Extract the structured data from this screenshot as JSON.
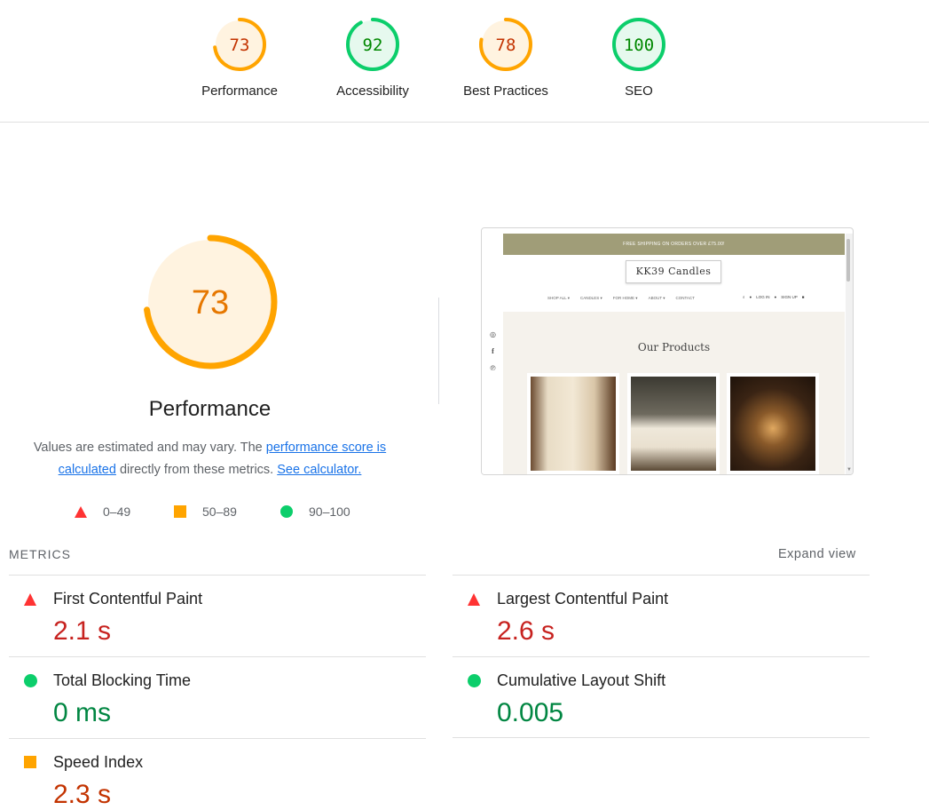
{
  "gauges": [
    {
      "label": "Performance",
      "score": "73",
      "value": 0.73,
      "color": "#ffa400",
      "bg": "#fff3e0",
      "text": "#c33300"
    },
    {
      "label": "Accessibility",
      "score": "92",
      "value": 0.92,
      "color": "#0cce6b",
      "bg": "#e6f9ee",
      "text": "#008800"
    },
    {
      "label": "Best Practices",
      "score": "78",
      "value": 0.78,
      "color": "#ffa400",
      "bg": "#fff3e0",
      "text": "#c33300"
    },
    {
      "label": "SEO",
      "score": "100",
      "value": 1.0,
      "color": "#0cce6b",
      "bg": "#e6f9ee",
      "text": "#008800"
    }
  ],
  "performance": {
    "score": "73",
    "value": 0.73,
    "title": "Performance",
    "desc_prefix": "Values are estimated and may vary. The ",
    "link1": "performance score is calculated",
    "desc_mid": " directly from these metrics. ",
    "link2": "See calculator."
  },
  "legend": [
    {
      "shape": "triangle",
      "range": "0–49"
    },
    {
      "shape": "square",
      "range": "50–89"
    },
    {
      "shape": "circle",
      "range": "90–100"
    }
  ],
  "thumbnail": {
    "banner": "FREE SHIPPING ON ORDERS OVER £75.00!",
    "logo": "KK39 Candles",
    "nav": [
      "SHOP ALL ▾",
      "CANDLES ▾",
      "FOR HOME ▾",
      "ABOUT ▾",
      "CONTACT"
    ],
    "account": [
      "LOG IN",
      "SIGN UP"
    ],
    "section_title": "Our Products"
  },
  "metrics": {
    "header": "METRICS",
    "expand": "Expand view",
    "items": [
      {
        "name": "First Contentful Paint",
        "value": "2.1 s",
        "status": "red"
      },
      {
        "name": "Largest Contentful Paint",
        "value": "2.6 s",
        "status": "red"
      },
      {
        "name": "Total Blocking Time",
        "value": "0 ms",
        "status": "green"
      },
      {
        "name": "Cumulative Layout Shift",
        "value": "0.005",
        "status": "green"
      },
      {
        "name": "Speed Index",
        "value": "2.3 s",
        "status": "orange"
      }
    ]
  }
}
